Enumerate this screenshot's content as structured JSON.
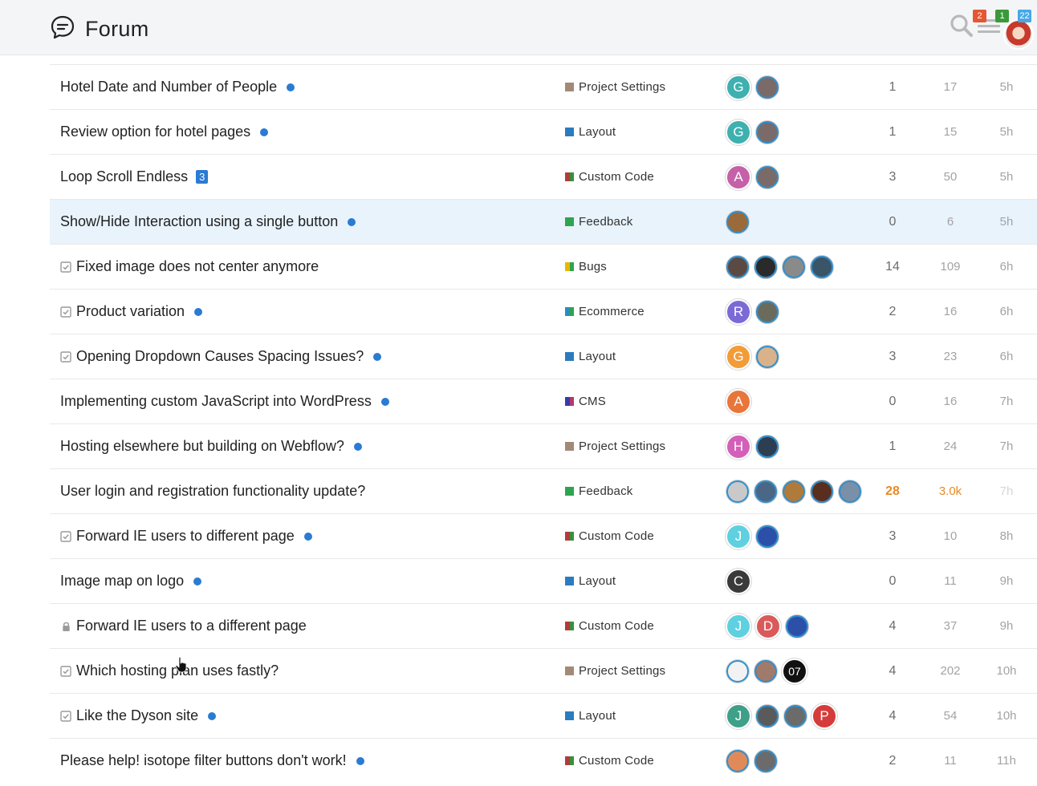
{
  "header": {
    "title": "Forum",
    "badges": {
      "notifications": "2",
      "messages": "1",
      "other": "22"
    }
  },
  "topics": [
    {
      "title": "Hotel Date and Number of People",
      "status": "",
      "marker": "dot",
      "count": "",
      "category": "Project Settings",
      "cat_colors": [
        "#a28a77"
      ],
      "avatars": [
        {
          "letter": "G",
          "color": "#3fb0b0"
        },
        {
          "letter": "",
          "color": "#7a6a68"
        }
      ],
      "replies": "1",
      "views": "17",
      "activity": "5h"
    },
    {
      "title": "Review option for hotel pages",
      "status": "",
      "marker": "dot",
      "count": "",
      "category": "Layout",
      "cat_colors": [
        "#2b7cbf"
      ],
      "avatars": [
        {
          "letter": "G",
          "color": "#3fb0b0"
        },
        {
          "letter": "",
          "color": "#7a6a68"
        }
      ],
      "replies": "1",
      "views": "15",
      "activity": "5h"
    },
    {
      "title": "Loop Scroll Endless",
      "status": "",
      "marker": "count",
      "count": "3",
      "category": "Custom Code",
      "cat_colors": [
        "#b33b3b",
        "#3b8f3b"
      ],
      "avatars": [
        {
          "letter": "A",
          "color": "#c561a8"
        },
        {
          "letter": "",
          "color": "#7a6a68"
        }
      ],
      "replies": "3",
      "views": "50",
      "activity": "5h"
    },
    {
      "title": "Show/Hide Interaction using a single button",
      "status": "",
      "marker": "dot",
      "count": "",
      "category": "Feedback",
      "cat_colors": [
        "#2ea44f"
      ],
      "avatars": [
        {
          "letter": "",
          "color": "#9a6a3a"
        }
      ],
      "replies": "0",
      "views": "6",
      "activity": "5h",
      "highlight": true
    },
    {
      "title": "Fixed image does not center anymore",
      "status": "check",
      "marker": "",
      "count": "",
      "category": "Bugs",
      "cat_colors": [
        "#e6b800",
        "#2ea44f"
      ],
      "avatars": [
        {
          "letter": "",
          "color": "#5b4a44"
        },
        {
          "letter": "",
          "color": "#2a2a2a"
        },
        {
          "letter": "",
          "color": "#8a8a8a"
        },
        {
          "letter": "",
          "color": "#3a5468"
        }
      ],
      "replies": "14",
      "views": "109",
      "activity": "6h"
    },
    {
      "title": "Product variation",
      "status": "check",
      "marker": "dot",
      "count": "",
      "category": "Ecommerce",
      "cat_colors": [
        "#2b8cbf",
        "#2ea44f"
      ],
      "avatars": [
        {
          "letter": "R",
          "color": "#7b6ad6"
        },
        {
          "letter": "",
          "color": "#6b6b5b"
        }
      ],
      "replies": "2",
      "views": "16",
      "activity": "6h"
    },
    {
      "title": "Opening Dropdown Causes Spacing Issues?",
      "status": "check",
      "marker": "dot",
      "count": "",
      "category": "Layout",
      "cat_colors": [
        "#2b7cbf"
      ],
      "avatars": [
        {
          "letter": "G",
          "color": "#f29c38"
        },
        {
          "letter": "",
          "color": "#d8b28a"
        }
      ],
      "replies": "3",
      "views": "23",
      "activity": "6h"
    },
    {
      "title": "Implementing custom JavaScript into WordPress",
      "status": "",
      "marker": "dot",
      "count": "",
      "category": "CMS",
      "cat_colors": [
        "#3a3aa8",
        "#b03a6b"
      ],
      "avatars": [
        {
          "letter": "A",
          "color": "#e8763b"
        }
      ],
      "replies": "0",
      "views": "16",
      "activity": "7h"
    },
    {
      "title": "Hosting elsewhere but building on Webflow?",
      "status": "",
      "marker": "dot",
      "count": "",
      "category": "Project Settings",
      "cat_colors": [
        "#a28a77"
      ],
      "avatars": [
        {
          "letter": "H",
          "color": "#d45fb8"
        },
        {
          "letter": "",
          "color": "#2c3e50"
        }
      ],
      "replies": "1",
      "views": "24",
      "activity": "7h"
    },
    {
      "title": "User login and registration functionality update?",
      "status": "",
      "marker": "",
      "count": "",
      "category": "Feedback",
      "cat_colors": [
        "#2ea44f"
      ],
      "avatars": [
        {
          "letter": "",
          "color": "#c9c9c9"
        },
        {
          "letter": "",
          "color": "#4a6785"
        },
        {
          "letter": "",
          "color": "#b07a3a"
        },
        {
          "letter": "",
          "color": "#5a2e1e"
        },
        {
          "letter": "",
          "color": "#7a8fa8"
        }
      ],
      "replies": "28",
      "views": "3.0k",
      "activity": "7h",
      "hot": true
    },
    {
      "title": "Forward IE users to different page",
      "status": "check",
      "marker": "dot",
      "count": "",
      "category": "Custom Code",
      "cat_colors": [
        "#b33b3b",
        "#3b8f3b"
      ],
      "avatars": [
        {
          "letter": "J",
          "color": "#5fd0e0"
        },
        {
          "letter": "",
          "color": "#2c4fa8"
        }
      ],
      "replies": "3",
      "views": "10",
      "activity": "8h"
    },
    {
      "title": "Image map on logo",
      "status": "",
      "marker": "dot",
      "count": "",
      "category": "Layout",
      "cat_colors": [
        "#2b7cbf"
      ],
      "avatars": [
        {
          "letter": "C",
          "color": "#3a3a3a"
        }
      ],
      "replies": "0",
      "views": "11",
      "activity": "9h"
    },
    {
      "title": "Forward IE users to a different page",
      "status": "lock",
      "marker": "",
      "count": "",
      "category": "Custom Code",
      "cat_colors": [
        "#b33b3b",
        "#3b8f3b"
      ],
      "avatars": [
        {
          "letter": "J",
          "color": "#5fd0e0"
        },
        {
          "letter": "D",
          "color": "#d95a5a"
        },
        {
          "letter": "",
          "color": "#2c4fa8"
        }
      ],
      "replies": "4",
      "views": "37",
      "activity": "9h"
    },
    {
      "title": "Which hosting plan uses fastly?",
      "status": "check",
      "marker": "",
      "count": "",
      "category": "Project Settings",
      "cat_colors": [
        "#a28a77"
      ],
      "avatars": [
        {
          "letter": "",
          "color": "#f2f2f2"
        },
        {
          "letter": "",
          "color": "#a07a6a"
        },
        {
          "letter": "07",
          "color": "#111111"
        }
      ],
      "replies": "4",
      "views": "202",
      "activity": "10h"
    },
    {
      "title": "Like the Dyson site",
      "status": "check",
      "marker": "dot",
      "count": "",
      "category": "Layout",
      "cat_colors": [
        "#2b7cbf"
      ],
      "avatars": [
        {
          "letter": "J",
          "color": "#3fa08a"
        },
        {
          "letter": "",
          "color": "#5a5a5a"
        },
        {
          "letter": "",
          "color": "#6b6b6b"
        },
        {
          "letter": "P",
          "color": "#d63b3b"
        }
      ],
      "replies": "4",
      "views": "54",
      "activity": "10h"
    },
    {
      "title": "Please help! isotope filter buttons don't work!",
      "status": "",
      "marker": "dot",
      "count": "",
      "category": "Custom Code",
      "cat_colors": [
        "#b33b3b",
        "#3b8f3b"
      ],
      "avatars": [
        {
          "letter": "",
          "color": "#e08a5a"
        },
        {
          "letter": "",
          "color": "#6b6b6b"
        }
      ],
      "replies": "2",
      "views": "11",
      "activity": "11h"
    }
  ]
}
